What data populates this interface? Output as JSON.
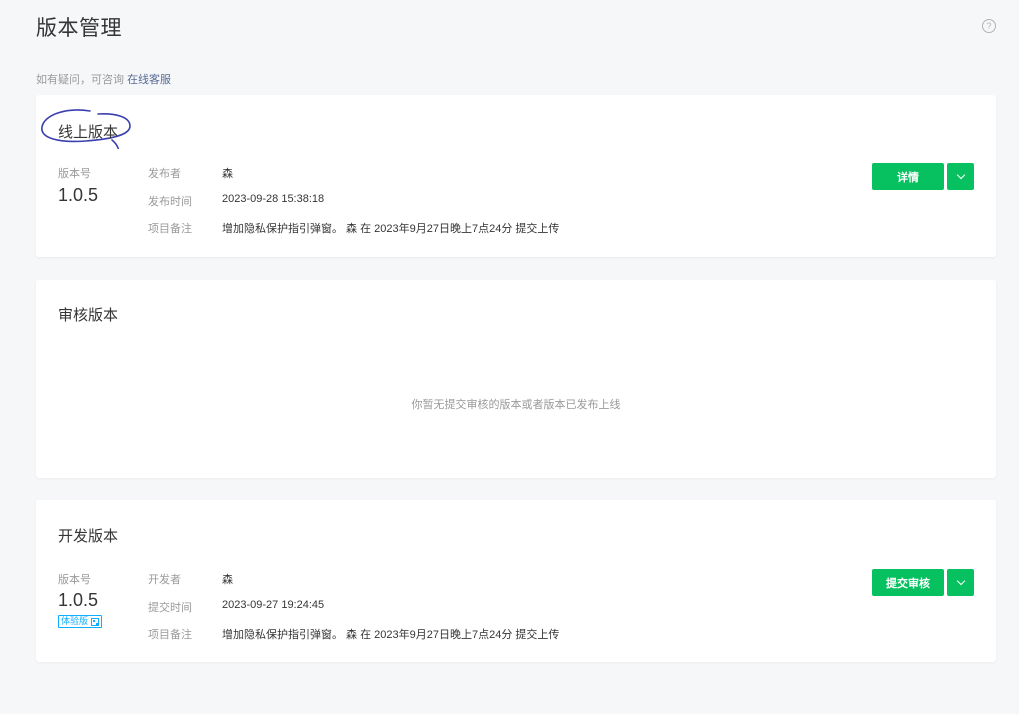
{
  "page": {
    "title": "版本管理"
  },
  "notice": {
    "text": "如有疑问，可咨询",
    "link": "在线客服"
  },
  "online": {
    "title": "线上版本",
    "version_label": "版本号",
    "version": "1.0.5",
    "meta": [
      {
        "key": "发布者",
        "value": "森"
      },
      {
        "key": "发布时间",
        "value": "2023-09-28 15:38:18"
      },
      {
        "key": "项目备注",
        "value": "增加隐私保护指引弹窗。 森 在 2023年9月27日晚上7点24分 提交上传"
      }
    ],
    "detail_button": "详情"
  },
  "review": {
    "title": "审核版本",
    "empty": "你暂无提交审核的版本或者版本已发布上线"
  },
  "dev": {
    "title": "开发版本",
    "version_label": "版本号",
    "version": "1.0.5",
    "badge": "体验版",
    "meta": [
      {
        "key": "开发者",
        "value": "森"
      },
      {
        "key": "提交时间",
        "value": "2023-09-27 19:24:45"
      },
      {
        "key": "项目备注",
        "value": "增加隐私保护指引弹窗。 森 在 2023年9月27日晚上7点24分 提交上传"
      }
    ],
    "submit_button": "提交审核"
  },
  "colors": {
    "primary": "#07c160",
    "link": "#576b95",
    "badge": "#10aeff",
    "annotation": "#3b3fb0"
  }
}
